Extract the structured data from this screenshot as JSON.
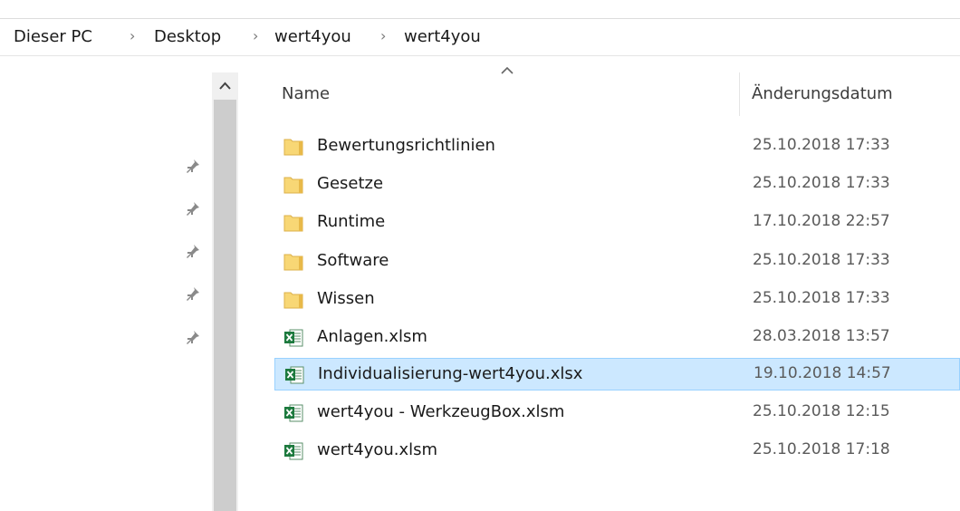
{
  "breadcrumb": [
    "Dieser PC",
    "Desktop",
    "wert4you",
    "wert4you"
  ],
  "columns": {
    "name": "Name",
    "date": "Änderungsdatum"
  },
  "sort": {
    "column": "Name",
    "direction": "ascending"
  },
  "files": [
    {
      "name": "Bewertungsrichtlinien",
      "date": "25.10.2018 17:33",
      "type": "folder",
      "selected": false
    },
    {
      "name": "Gesetze",
      "date": "25.10.2018 17:33",
      "type": "folder",
      "selected": false
    },
    {
      "name": "Runtime",
      "date": "17.10.2018 22:57",
      "type": "folder",
      "selected": false
    },
    {
      "name": "Software",
      "date": "25.10.2018 17:33",
      "type": "folder",
      "selected": false
    },
    {
      "name": "Wissen",
      "date": "25.10.2018 17:33",
      "type": "folder",
      "selected": false
    },
    {
      "name": "Anlagen.xlsm",
      "date": "28.03.2018 13:57",
      "type": "excel",
      "selected": false
    },
    {
      "name": "Individualisierung-wert4you.xlsx",
      "date": "19.10.2018 14:57",
      "type": "excel",
      "selected": true
    },
    {
      "name": "wert4you - WerkzeugBox.xlsm",
      "date": "25.10.2018 12:15",
      "type": "excel",
      "selected": false
    },
    {
      "name": "wert4you.xlsm",
      "date": "25.10.2018 17:18",
      "type": "excel",
      "selected": false
    }
  ],
  "colors": {
    "selection": "#cce8ff",
    "selection_border": "#99d1ff",
    "folder": "#f8d775",
    "excel": "#1d7a3e"
  },
  "icons": {
    "folder": "folder-icon",
    "excel": "excel-file-icon",
    "pin": "pin-icon"
  }
}
